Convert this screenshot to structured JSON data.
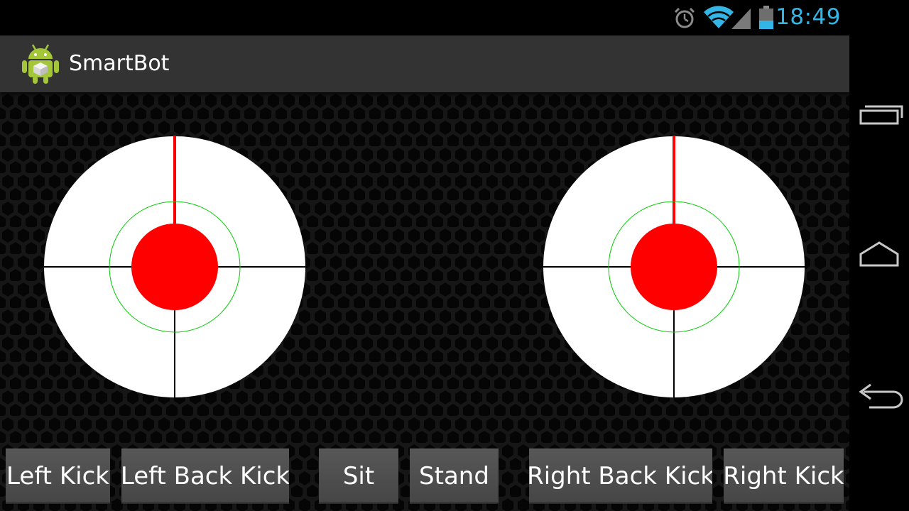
{
  "status_bar": {
    "time": "18:49",
    "icons": [
      "alarm-icon",
      "wifi-icon",
      "cell-signal-icon",
      "battery-icon"
    ],
    "accent_color": "#33b5e5"
  },
  "action_bar": {
    "app_icon": "android-robot-icon",
    "title": "SmartBot"
  },
  "joysticks": {
    "left": {
      "name": "left-joystick",
      "knob_color": "#ff0000",
      "ring_color": "#00cc00"
    },
    "right": {
      "name": "right-joystick",
      "knob_color": "#ff0000",
      "ring_color": "#00cc00"
    }
  },
  "buttons": {
    "left_kick": "Left Kick",
    "left_back_kick": "Left Back Kick",
    "sit": "Sit",
    "stand": "Stand",
    "right_back_kick": "Right Back Kick",
    "right_kick": "Right Kick"
  },
  "nav_bar": {
    "buttons": [
      "recent-apps-icon",
      "home-icon",
      "back-icon"
    ]
  }
}
